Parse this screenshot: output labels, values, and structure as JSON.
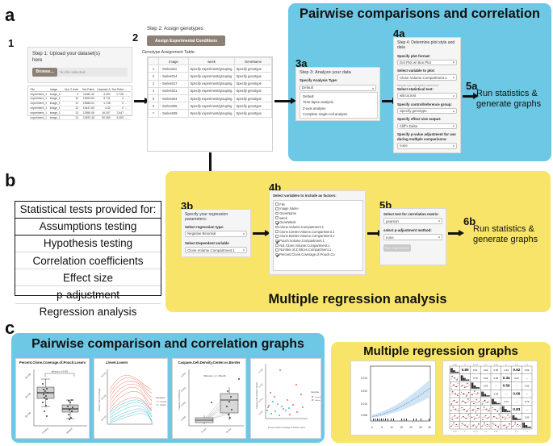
{
  "panels": {
    "a": "a",
    "b": "b",
    "c": "c"
  },
  "banners": {
    "pairwise_top": "Pairwise comparisons and correlation",
    "multiple_regression": "Multiple regression analysis",
    "pairwise_graphs": "Pairwise comparison and correlation graphs",
    "regression_graphs": "Multiple regression graphs"
  },
  "steps": {
    "one": "1",
    "two": "2",
    "three_a": "3a",
    "four_a": "4a",
    "five_a": "5a",
    "three_b": "3b",
    "four_b": "4b",
    "five_b": "5b",
    "six_b": "6b"
  },
  "step1": {
    "title": "Step 1: Upload your dataset(s) here",
    "browse_label": "Browse...",
    "file_status": "No file selected",
    "table": {
      "headers": [
        "File",
        "Image",
        "Nuc Z level",
        "Not.Patch",
        "Caspase.A",
        "Not.Patch",
        "..."
      ],
      "rows": [
        [
          "experiment_1",
          "image_1",
          "9",
          "11082.32",
          "3.492",
          "0.728",
          "..."
        ],
        [
          "experiment_1",
          "image_1",
          "10",
          "13094.62",
          "8.711",
          "0",
          "..."
        ],
        [
          "experiment_1",
          "image_1",
          "11",
          "15566.01",
          "1.746",
          "0",
          "..."
        ],
        [
          "experiment_1",
          "image_1",
          "12",
          "13447.60",
          "3.42",
          "0",
          "..."
        ],
        [
          "experiment_1",
          "image_1",
          "13",
          "13950.06",
          "16.007",
          "2.547",
          "..."
        ],
        [
          "experiment_1",
          "image_1",
          "14",
          "13492.48",
          "50.069",
          "6.409",
          "..."
        ]
      ]
    }
  },
  "step2": {
    "title": "Step 2: Assign genotypes",
    "assign_button": "Assign Experimental Conditions",
    "table_caption": "Genotype Assignment Table:",
    "headers": [
      "",
      "Image",
      "week",
      "GeneName"
    ],
    "rows": [
      {
        "idx": "1",
        "image": "- Series011",
        "week": "Specify experiment/grouping",
        "gene": "Specify genotype"
      },
      {
        "idx": "2",
        "image": "- Series014",
        "week": "Specify experiment/grouping",
        "gene": "Specify genotype"
      },
      {
        "idx": "3",
        "image": "- Series017",
        "week": "Specify experiment/grouping",
        "gene": "Specify genotype"
      },
      {
        "idx": "4",
        "image": "- Series021",
        "week": "Specify experiment/grouping",
        "gene": "Specify genotype"
      },
      {
        "idx": "5",
        "image": "- Series024",
        "week": "Specify experiment/grouping",
        "gene": "Specify genotype"
      },
      {
        "idx": "6",
        "image": "- Series026",
        "week": "Specify experiment/grouping",
        "gene": "Specify genotype"
      },
      {
        "idx": "7",
        "image": "- Series029",
        "week": "Specify experiment/grouping",
        "gene": "Specify genotype"
      }
    ]
  },
  "step3a": {
    "title": "Step 3: Analyze your data",
    "field_label": "Specify Analysis Type:",
    "selected": "Default",
    "options": [
      "Default",
      "Time-lapse analysis",
      "Z-axis analysis",
      "Complete single-cell analysis"
    ]
  },
  "step4a": {
    "title": "Step 4: Determine plot style and data",
    "fields": [
      {
        "label": "Specify plot format:",
        "value": "Dot Plot w/ Box Plot",
        "hint": ""
      },
      {
        "label": "Select variable to plot:",
        "value": "Clone.Volume.Compartment.1",
        "hint": ""
      },
      {
        "label": "Select statistical test:",
        "value": "wilcox.test",
        "hint": "Needs two variables selection"
      },
      {
        "label": "Specify control/reference group:",
        "value": "Specify genotype",
        "hint": ""
      },
      {
        "label": "Specify effect size output:",
        "value": "Cliff's Delta",
        "hint": ""
      },
      {
        "label": "Specify p-value adjustment for use during multiple comparisons:",
        "value": "none",
        "hint": ""
      }
    ]
  },
  "step5a": {
    "text": "Run statistics & generate graphs"
  },
  "stat_tests": {
    "header": "Statistical tests provided for:",
    "items": [
      "Assumptions testing",
      "Hypothesis testing",
      "Correlation coefficients",
      "Effect size",
      "p-adjustment",
      "Regression analysis"
    ]
  },
  "step3b": {
    "title": "Specify your regression parameters:",
    "fields": [
      {
        "label": "Select regression type:",
        "value": "Negative Binomial"
      },
      {
        "label": "Select Dependent variable",
        "value": "Clone.Volume.Compartment.1"
      }
    ]
  },
  "step4b": {
    "title": "Select variables to include as factors:",
    "items": [
      {
        "label": "File",
        "checked": false
      },
      {
        "label": "Image.Name",
        "checked": false
      },
      {
        "label": "GeneName",
        "checked": false
      },
      {
        "label": "week",
        "checked": false
      },
      {
        "label": "GeneWeek",
        "checked": true
      },
      {
        "label": "Clone.Volume.Compartment.1",
        "checked": false
      },
      {
        "label": "Clone.Center.Volume.Compartment.1",
        "checked": false
      },
      {
        "label": "Clone.Border.Volume.Compartment.1",
        "checked": false
      },
      {
        "label": "Pouch.Volume.Compartment.1",
        "checked": true
      },
      {
        "label": "Not.Clone.Volume.Compartment.1",
        "checked": false
      },
      {
        "label": "Number.of.Z.Slices.Compartment.1",
        "checked": false
      },
      {
        "label": "Percent.Clone.Coverage.of.Pouch.Co",
        "checked": true
      }
    ]
  },
  "step5b": {
    "fields": [
      {
        "label": "Select test for correlation matrix:",
        "value": "pearson"
      },
      {
        "label": "select p-adjustment method:",
        "value": "none"
      }
    ],
    "run_button": "Run regression!"
  },
  "step6b": {
    "text": "Run statistics & generate graphs"
  },
  "graphs": {
    "pairwise": [
      {
        "title": "Percent.Clone.Coverage.of.Pouch.Losers",
        "annotation": "wilcoxon, p<0.001",
        "ylabel": "Percent Clone Coverage of Pouch"
      },
      {
        "title": "z.level.Losers",
        "ylabel": "Percent Clone Coverage of Pouch Losers",
        "legend_title": "Genotype"
      },
      {
        "title": "Caspase.Cell.Density.Center.vs.Border",
        "annotation": "Wilcoxon, p = 3.8e-06",
        "ylabel": "Caspase Cell Density"
      },
      {
        "title": "",
        "xlabel": "Percent Clone Coverage of Pouch Losers",
        "ylabel": "Caspase Cell Density in Border Losers",
        "legend_title": "Genotype"
      }
    ],
    "regression": [
      {
        "type": "regression-fit",
        "ylabels": [
          "0.008",
          "0.010",
          "0.012",
          "0.014"
        ],
        "xlabels": [
          "0",
          "5",
          "10",
          "15",
          "20",
          "25",
          "30"
        ]
      },
      {
        "type": "correlation-matrix",
        "correlations": [
          "0.89",
          "0.51",
          "0.83",
          "0.65",
          "0.94",
          "0.62",
          "0.59",
          "0.78",
          "0.64",
          "0.38",
          "0.34",
          "0.64"
        ]
      }
    ]
  },
  "colors": {
    "blue": "#6cc8e4",
    "yellow": "#f9e46a",
    "grey_button": "#8d8176",
    "text": "#111111"
  }
}
